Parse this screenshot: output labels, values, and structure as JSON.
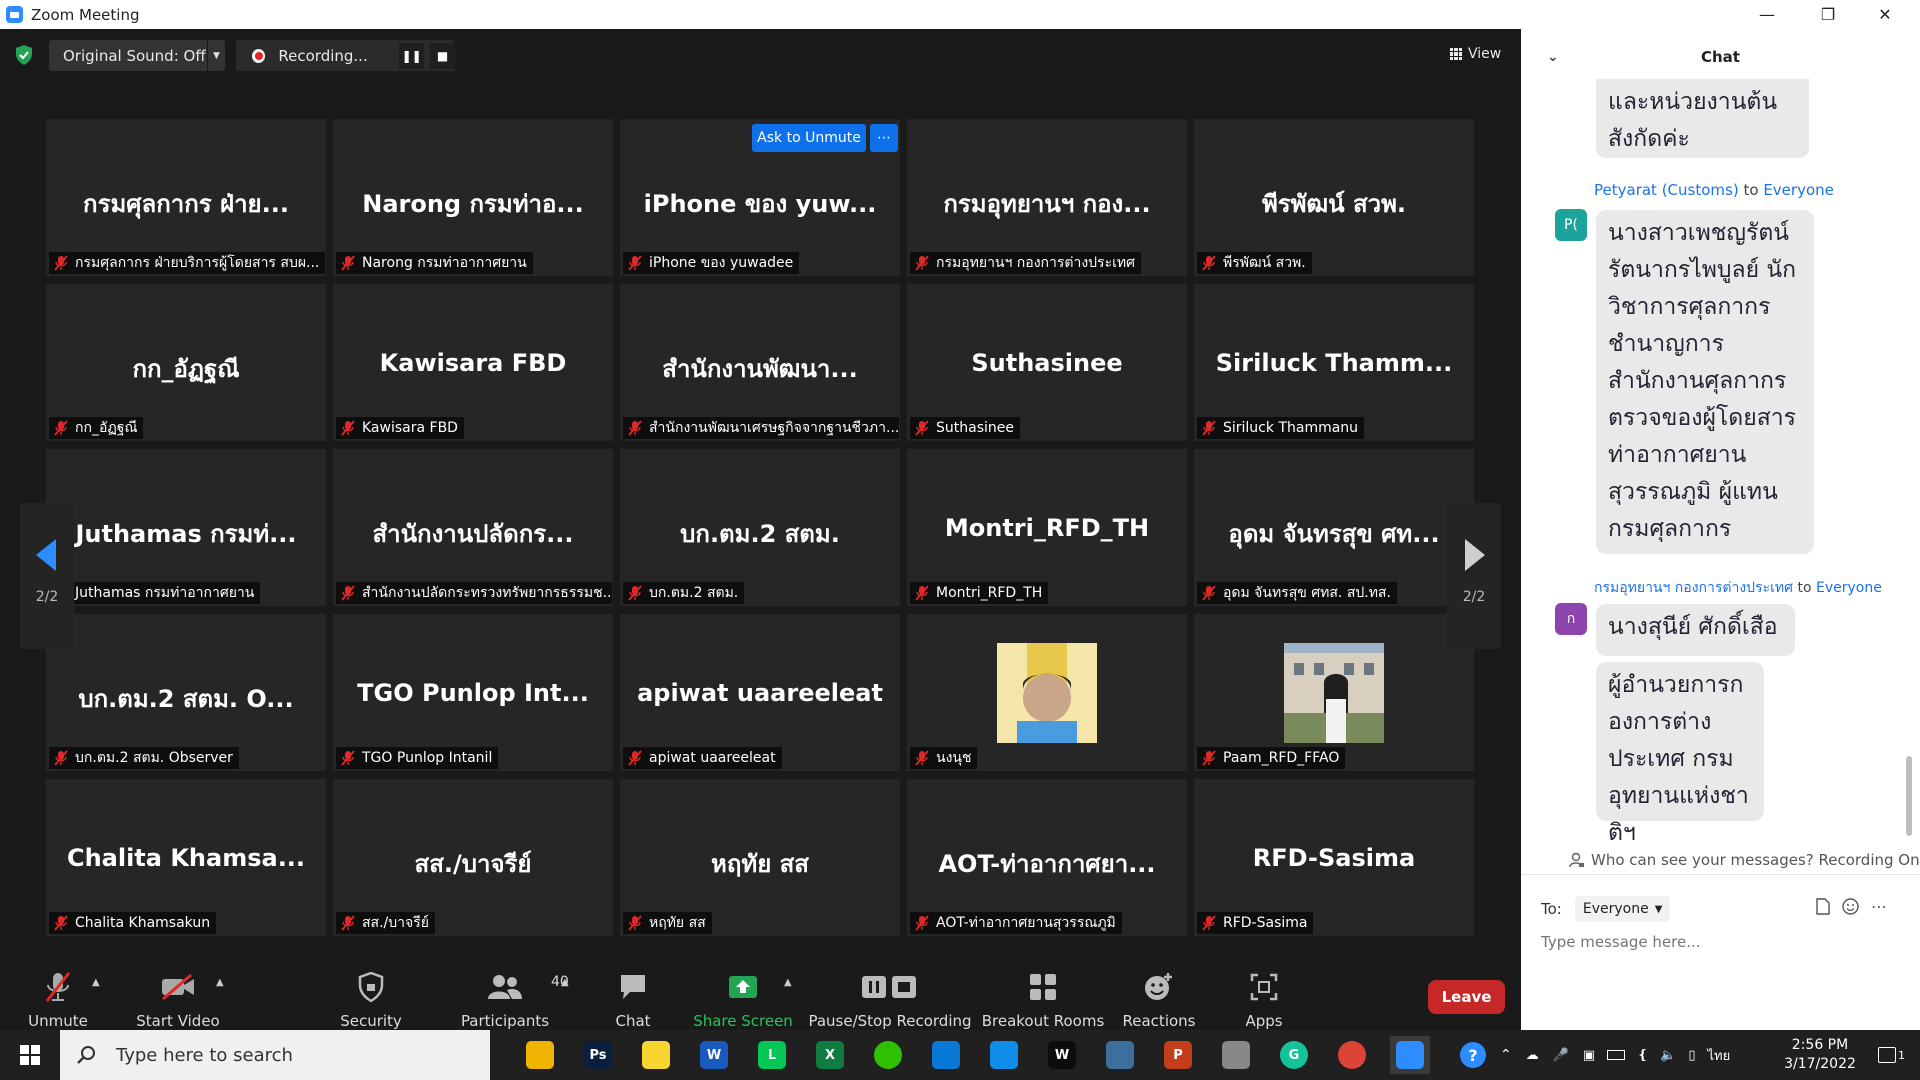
{
  "window": {
    "title": "Zoom Meeting"
  },
  "topbar": {
    "original_sound": "Original Sound: Off",
    "recording": "Recording...",
    "view": "View"
  },
  "ask_unmute": "Ask to Unmute",
  "ask_more": "⋯",
  "pager": {
    "page": "2/2"
  },
  "tiles": [
    {
      "display": "กรมศุลกากร ฝ่าย...",
      "caption": "กรมศุลกากร ฝ่ายบริการผู้โดยสาร สบผ..."
    },
    {
      "display": "Narong กรมท่าอ...",
      "caption": "Narong กรมท่าอากาศยาน"
    },
    {
      "display": "iPhone ของ yuw...",
      "caption": "iPhone ของ yuwadee"
    },
    {
      "display": "กรมอุทยานฯ กอง...",
      "caption": "กรมอุทยานฯ กองการต่างประเทศ"
    },
    {
      "display": "พีรพัฒน์ สวพ.",
      "caption": "พีรพัฒน์ สวพ."
    },
    {
      "display": "กก_อัฏฐณี",
      "caption": "กก_อัฏฐณี"
    },
    {
      "display": "Kawisara FBD",
      "caption": "Kawisara FBD"
    },
    {
      "display": "สำนักงานพัฒนา...",
      "caption": "สำนักงานพัฒนาเศรษฐกิจจากฐานชีวภา..."
    },
    {
      "display": "Suthasinee",
      "caption": "Suthasinee"
    },
    {
      "display": "Siriluck  Thamm...",
      "caption": "Siriluck Thammanu"
    },
    {
      "display": "Juthamas กรมท่...",
      "caption": "Juthamas กรมท่าอากาศยาน"
    },
    {
      "display": "สำนักงานปลัดกร...",
      "caption": "สำนักงานปลัดกระทรวงทรัพยากรธรรมช..."
    },
    {
      "display": "บก.ตม.2 สตม.",
      "caption": "บก.ตม.2 สตม."
    },
    {
      "display": "Montri_RFD_TH",
      "caption": "Montri_RFD_TH"
    },
    {
      "display": "อุดม จันทรสุข ศท...",
      "caption": "อุดม จันทรสุข ศทส. สป.ทส."
    },
    {
      "display": "บก.ตม.2 สตม. O...",
      "caption": "บก.ตม.2 สตม. Observer"
    },
    {
      "display": "TGO Punlop Int...",
      "caption": "TGO Punlop Intanil"
    },
    {
      "display": "apiwat uaareeleat",
      "caption": "apiwat uaareeleat"
    },
    {
      "display": "",
      "caption": "นงนุช"
    },
    {
      "display": "",
      "caption": "Paam_RFD_FFAO"
    },
    {
      "display": "Chalita  Khamsa...",
      "caption": "Chalita Khamsakun"
    },
    {
      "display": "สส./บาจรีย์",
      "caption": "สส./บาจรีย์"
    },
    {
      "display": "หฤทัย สส",
      "caption": "หฤทัย สส"
    },
    {
      "display": "AOT-ท่าอากาศยา...",
      "caption": "AOT-ท่าอากาศยานสุวรรณภูมิ"
    },
    {
      "display": "RFD-Sasima",
      "caption": "RFD-Sasima"
    }
  ],
  "toolbar": {
    "unmute": "Unmute",
    "start_video": "Start Video",
    "security": "Security",
    "participants": "Participants",
    "participants_count": "40",
    "chat": "Chat",
    "share_screen": "Share Screen",
    "pause_stop": "Pause/Stop Recording",
    "breakout": "Breakout Rooms",
    "reactions": "Reactions",
    "apps": "Apps",
    "leave": "Leave"
  },
  "chat": {
    "title": "Chat",
    "msg0": "และหน่วยงานต้นสังกัดค่ะ",
    "sender1": "Petyarat (Customs)",
    "to_word": "to",
    "everyone": "Everyone",
    "avatar1": "P(",
    "avatar1_color": "#1ba39c",
    "msg1": "นางสาวเพชญรัตน์ รัตนากรไพบูลย์ นักวิชาการศุลกากรชำนาญการ สำนักงานศุลกากรตรวจของผู้โดยสาร ท่าอากาศยานสุวรรณภูมิ ผู้แทนกรมศุลกากร",
    "sender2": "กรมอุทยานฯ กองการต่างประเทศ",
    "avatar2": "ก",
    "avatar2_color": "#8e44ad",
    "msg2": "นางสุนีย์ ศักดิ์เสือ",
    "msg3": "ผู้อำนวยการกองการต่างประเทศ กรมอุทยานแห่งชาติฯ",
    "who_can_see": "Who can see your messages? Recording On",
    "to_label": "To:",
    "to_value": "Everyone",
    "placeholder": "Type message here..."
  },
  "taskbar": {
    "search_placeholder": "Type here to search",
    "time": "2:56 PM",
    "date": "3/17/2022",
    "lang": "ไทย",
    "notif_count": "1"
  },
  "colors": {
    "accent": "#0e71eb",
    "leave": "#c62828",
    "share": "#23a455",
    "mic_off": "#e02828"
  }
}
